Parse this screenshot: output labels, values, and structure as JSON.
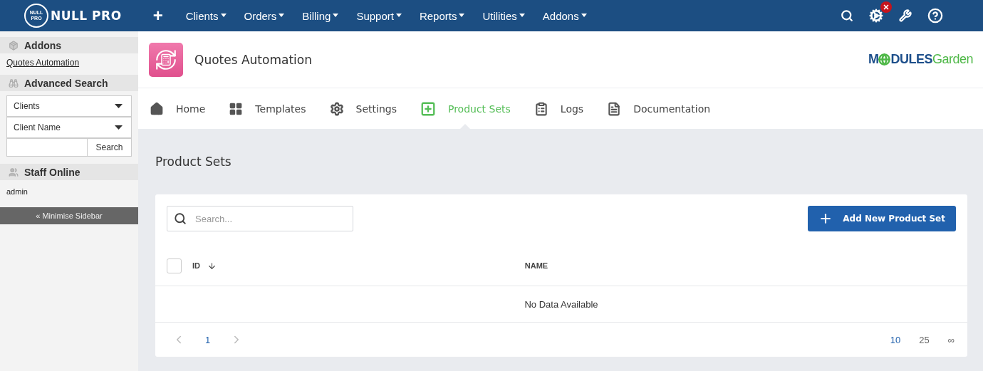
{
  "topbar": {
    "logo_badge": [
      "NULL",
      "PRO"
    ],
    "logo_text": "NULL PRO",
    "add": "+",
    "menu": [
      {
        "label": "Clients"
      },
      {
        "label": "Orders"
      },
      {
        "label": "Billing"
      },
      {
        "label": "Support"
      },
      {
        "label": "Reports"
      },
      {
        "label": "Utilities"
      },
      {
        "label": "Addons"
      }
    ],
    "alert": true
  },
  "sidebar": {
    "sections": [
      {
        "kind": "links",
        "title": "Addons",
        "links": [
          "Quotes Automation"
        ]
      },
      {
        "kind": "search",
        "title": "Advanced Search",
        "selects": [
          "Clients",
          "Client Name"
        ],
        "button": "Search"
      },
      {
        "kind": "text",
        "title": "Staff Online",
        "lines": [
          "admin"
        ]
      }
    ],
    "minimise": "« Minimise Sidebar"
  },
  "module": {
    "title": "Quotes Automation",
    "brand": {
      "left": "M",
      "middle": "DULES",
      "right": "Garden"
    },
    "tabs": [
      {
        "label": "Home",
        "selected": false
      },
      {
        "label": "Templates",
        "selected": false
      },
      {
        "label": "Settings",
        "selected": false
      },
      {
        "label": "Product Sets",
        "selected": true
      },
      {
        "label": "Logs",
        "selected": false
      },
      {
        "label": "Documentation",
        "selected": false
      }
    ]
  },
  "page": {
    "heading": "Product Sets",
    "table": {
      "search": {
        "placeholder": "Search..."
      },
      "add_button": "Add New Product Set",
      "select_all": {
        "checked": false
      },
      "columns": [
        {
          "label": "ID",
          "sorted": true
        },
        {
          "label": "NAME",
          "sorted": false
        }
      ],
      "empty": "No Data Available",
      "pagination": {
        "pages": [
          {
            "label": "1",
            "selected": true
          }
        ]
      },
      "page_sizes": [
        {
          "label": "10",
          "selected": true
        },
        {
          "label": "25",
          "selected": false
        },
        {
          "label": "∞",
          "selected": false
        }
      ]
    }
  }
}
